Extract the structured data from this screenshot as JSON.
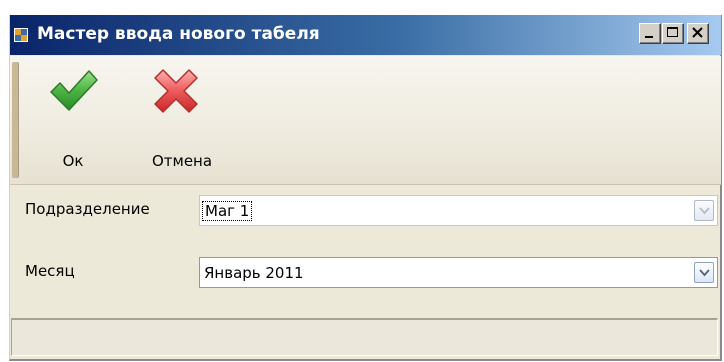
{
  "window": {
    "title": "Мастер ввода нового табеля",
    "icon": "app-window-icon",
    "controls": [
      "minimize-icon",
      "maximize-icon",
      "close-icon"
    ]
  },
  "toolbar": {
    "ok_label": "Ок",
    "ok_icon": "green-checkmark-icon",
    "cancel_label": "Отмена",
    "cancel_icon": "red-cross-icon"
  },
  "form": {
    "department_label": "Подразделение",
    "department_value": "Маг 1",
    "month_label": "Месяц",
    "month_value": "Январь 2011"
  },
  "colors": {
    "titlebar_start": "#0a246a",
    "titlebar_end": "#a6caf0",
    "window_bg": "#ece9d8",
    "ok_green": "#3fa83a",
    "cancel_red": "#e04040"
  }
}
